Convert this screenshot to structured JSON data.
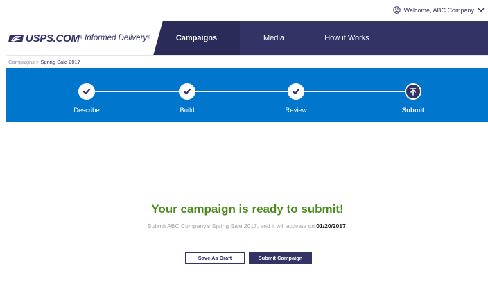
{
  "user_menu": {
    "welcome_text": "Welcome, ABC Company",
    "icon": "user-circle-icon",
    "chevron": "chevron-down-icon"
  },
  "brand": {
    "logo_icon": "usps-eagle-icon",
    "name": "USPS.COM",
    "name_mark": "®",
    "product": "Informed Delivery",
    "product_mark": "®"
  },
  "nav": {
    "items": [
      {
        "label": "Campaigns",
        "active": true
      },
      {
        "label": "Media",
        "active": false
      },
      {
        "label": "How it Works",
        "active": false
      }
    ]
  },
  "breadcrumb": {
    "parent": "Campaigns",
    "separator": ">",
    "current": "Spring Sale 2017"
  },
  "progress": {
    "steps": [
      {
        "label": "Describe",
        "status": "complete",
        "icon": "check-icon"
      },
      {
        "label": "Build",
        "status": "complete",
        "icon": "check-icon"
      },
      {
        "label": "Review",
        "status": "complete",
        "icon": "check-icon"
      },
      {
        "label": "Submit",
        "status": "current",
        "icon": "upload-arrow-icon"
      }
    ]
  },
  "main": {
    "title": "Your campaign is ready to submit!",
    "subtitle_prefix": "Submit ABC Company's Spring Sale 2017, and it will activate on ",
    "activation_date": "01/20/2017",
    "subtitle_suffix": ".",
    "save_draft_label": "Save As Draft",
    "submit_label": "Submit Campaign"
  },
  "colors": {
    "brand_navy": "#333366",
    "progress_blue": "#0077cc",
    "success_green": "#4c8c1f"
  }
}
